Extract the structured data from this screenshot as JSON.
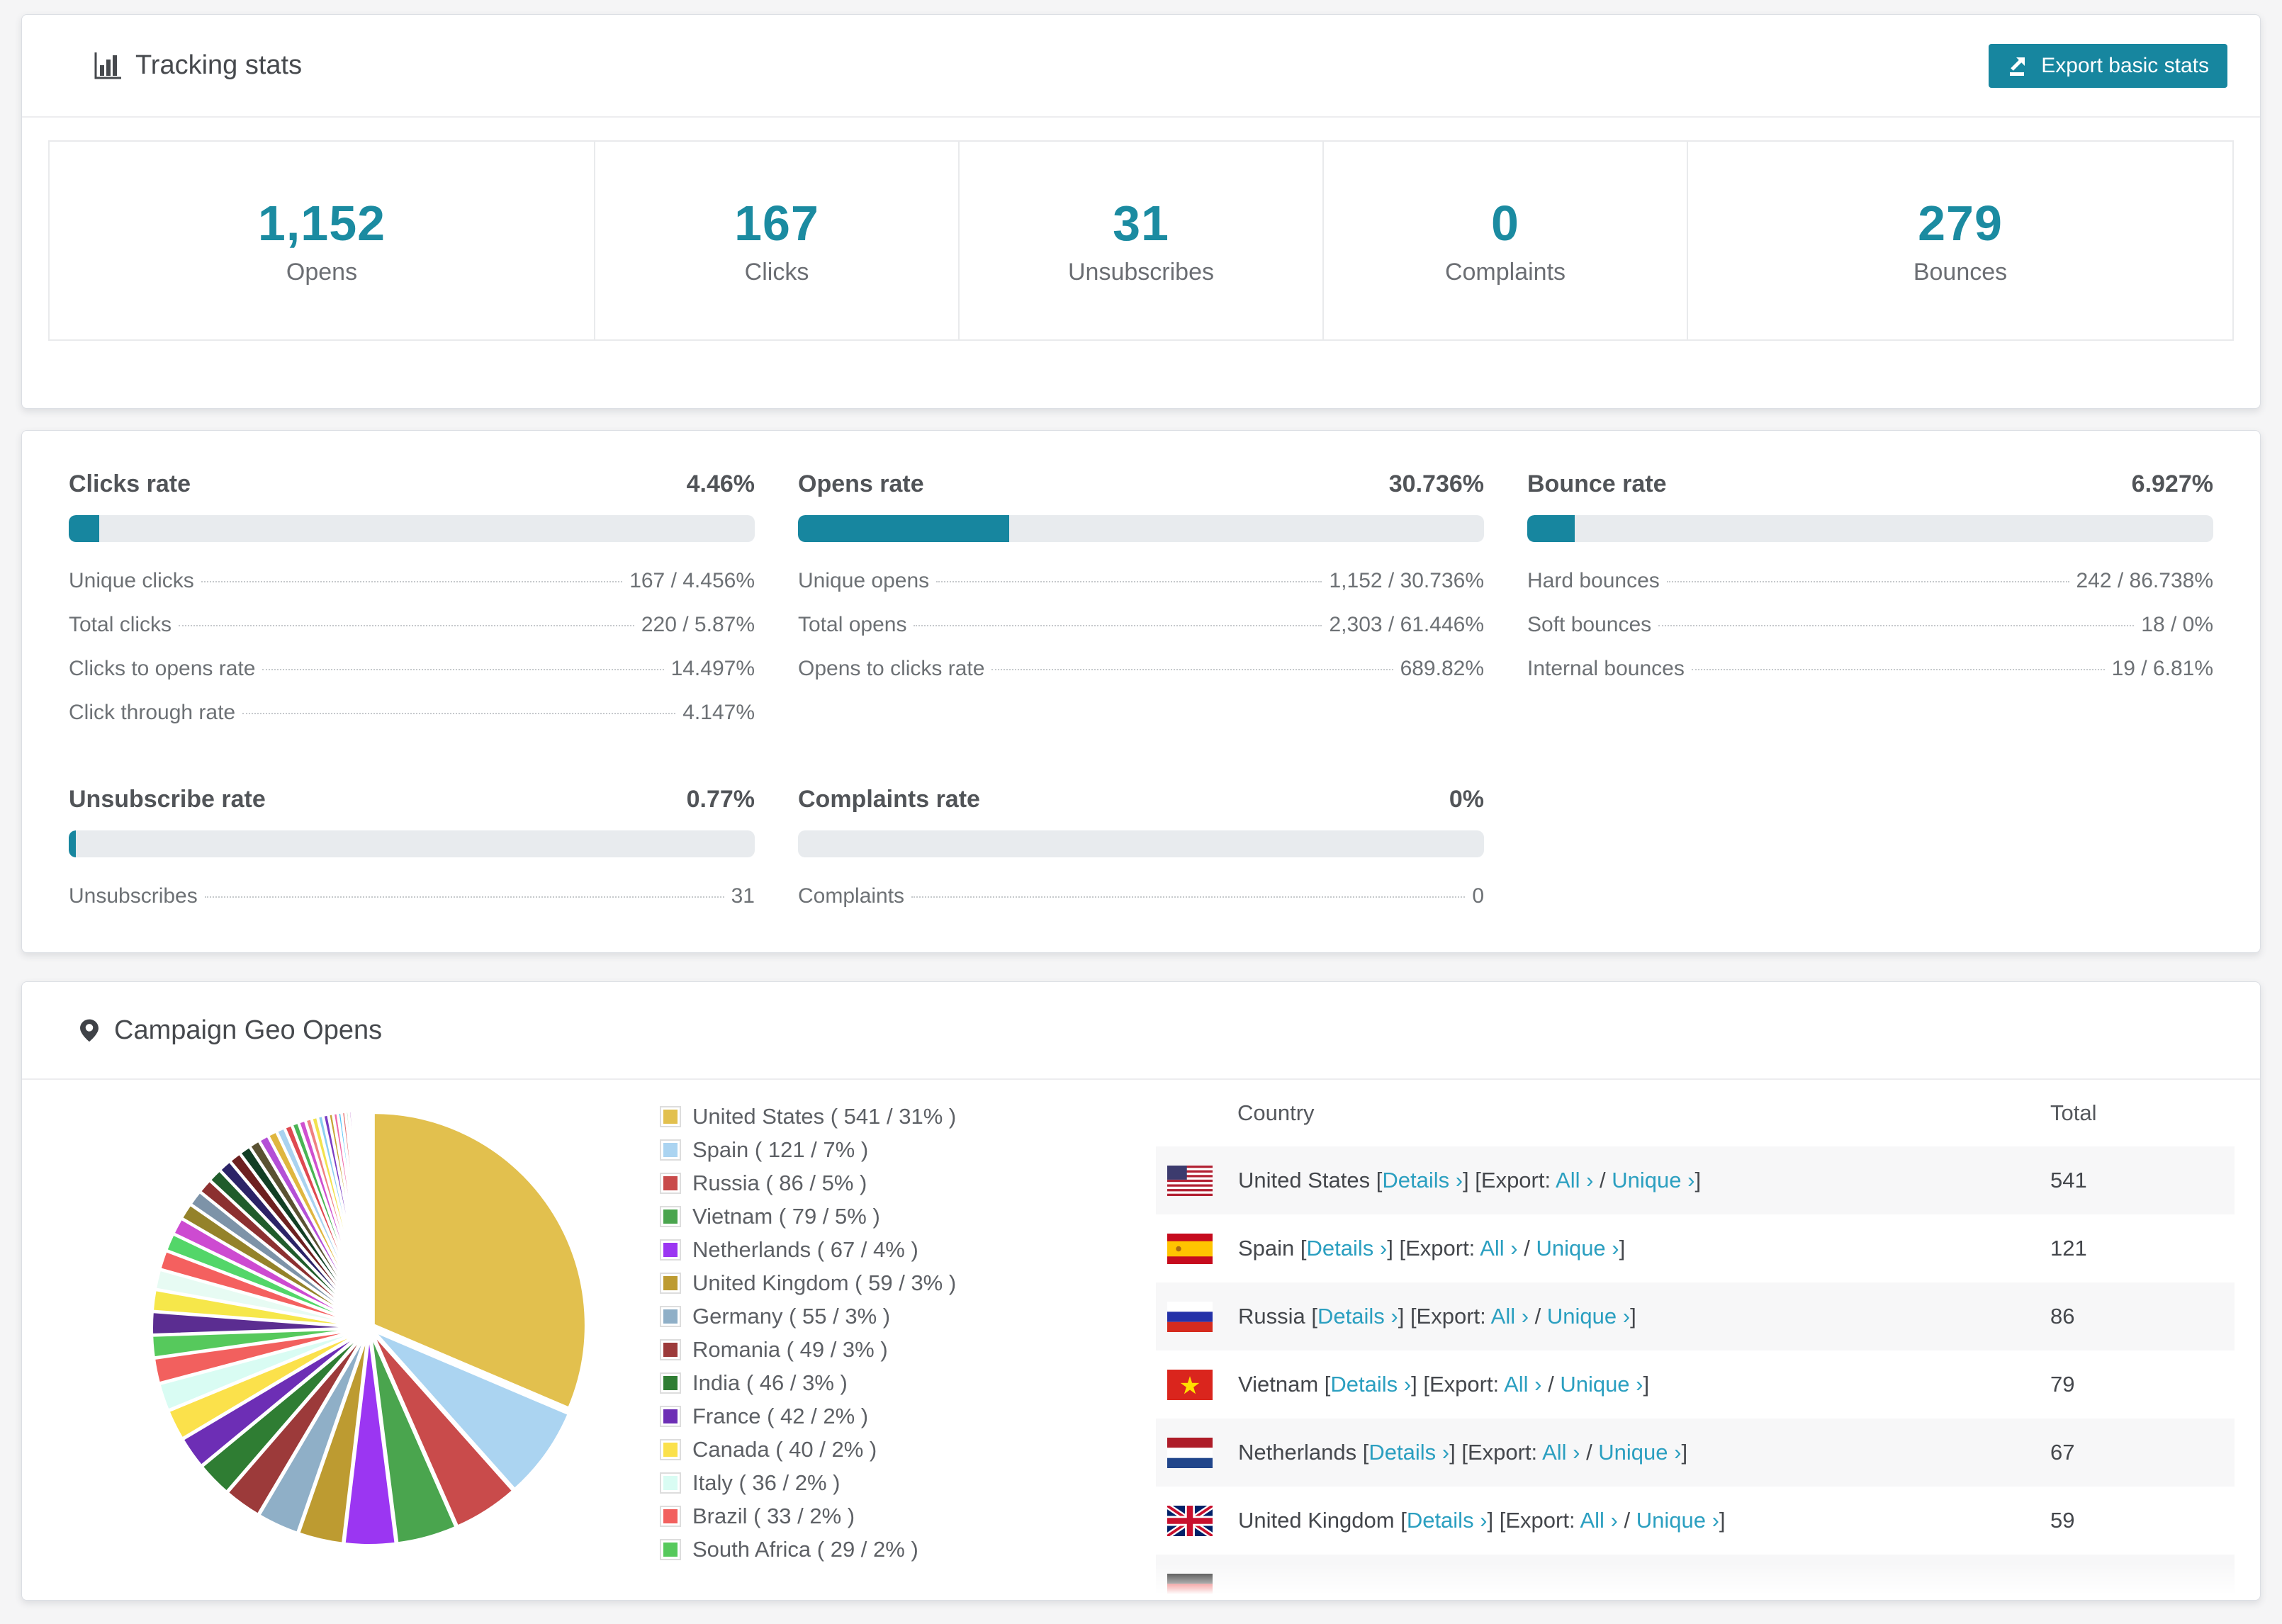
{
  "colors": {
    "accent_teal": "#17869f",
    "stat_number_teal": "#1b8ba1",
    "link_teal": "#2b9fc0",
    "track_gray": "#e8ebee"
  },
  "tracking": {
    "title": "Tracking stats",
    "export_button": "Export basic stats",
    "stats": [
      {
        "value": "1,152",
        "label": "Opens"
      },
      {
        "value": "167",
        "label": "Clicks"
      },
      {
        "value": "31",
        "label": "Unsubscribes"
      },
      {
        "value": "0",
        "label": "Complaints"
      },
      {
        "value": "279",
        "label": "Bounces"
      }
    ]
  },
  "rates": {
    "sections": [
      {
        "title": "Clicks rate",
        "value": "4.46%",
        "percent": 4.46,
        "rows": [
          {
            "label": "Unique clicks",
            "value": "167 / 4.456%"
          },
          {
            "label": "Total clicks",
            "value": "220 / 5.87%"
          },
          {
            "label": "Clicks to opens rate",
            "value": "14.497%"
          },
          {
            "label": "Click through rate",
            "value": "4.147%"
          }
        ]
      },
      {
        "title": "Opens rate",
        "value": "30.736%",
        "percent": 30.736,
        "rows": [
          {
            "label": "Unique opens",
            "value": "1,152 / 30.736%"
          },
          {
            "label": "Total opens",
            "value": "2,303 / 61.446%"
          },
          {
            "label": "Opens to clicks rate",
            "value": "689.82%"
          }
        ]
      },
      {
        "title": "Bounce rate",
        "value": "6.927%",
        "percent": 6.927,
        "rows": [
          {
            "label": "Hard bounces",
            "value": "242 / 86.738%"
          },
          {
            "label": "Soft bounces",
            "value": "18 / 0%"
          },
          {
            "label": "Internal bounces",
            "value": "19 / 6.81%"
          }
        ]
      },
      {
        "title": "Unsubscribe rate",
        "value": "0.77%",
        "percent": 0.77,
        "rows": [
          {
            "label": "Unsubscribes",
            "value": "31"
          }
        ]
      },
      {
        "title": "Complaints rate",
        "value": "0%",
        "percent": 0,
        "rows": [
          {
            "label": "Complaints",
            "value": "0"
          }
        ]
      }
    ]
  },
  "geo": {
    "title": "Campaign Geo Opens",
    "table": {
      "headers": [
        "Country",
        "Total"
      ],
      "links": {
        "details": "Details ›",
        "export_prefix": "[Export:",
        "all": "All ›",
        "unique": "Unique ›"
      },
      "rows": [
        {
          "flag": "us",
          "country": "United States",
          "total": "541",
          "links": true
        },
        {
          "flag": "es",
          "country": "Spain",
          "total": "121",
          "links": true
        },
        {
          "flag": "ru",
          "country": "Russia",
          "total": "86",
          "links": true
        },
        {
          "flag": "vn",
          "country": "Vietnam",
          "total": "79",
          "links": true
        },
        {
          "flag": "nl",
          "country": "Netherlands",
          "total": "67",
          "links": true
        },
        {
          "flag": "gb",
          "country": "United Kingdom",
          "total": "59",
          "links": true
        },
        {
          "flag": "de",
          "country": "",
          "total": "",
          "links": false
        }
      ]
    },
    "legend": [
      {
        "label": "United States ( 541 / 31% )",
        "color": "#e2c04e"
      },
      {
        "label": "Spain ( 121 / 7% )",
        "color": "#abd4f1"
      },
      {
        "label": "Russia ( 86 / 5% )",
        "color": "#c94b4b"
      },
      {
        "label": "Vietnam ( 79 / 5% )",
        "color": "#4aa54e"
      },
      {
        "label": "Netherlands ( 67 / 4% )",
        "color": "#9b36f2"
      },
      {
        "label": "United Kingdom ( 59 / 3% )",
        "color": "#bd9b31"
      },
      {
        "label": "Germany ( 55 / 3% )",
        "color": "#8fafc7"
      },
      {
        "label": "Romania ( 49 / 3% )",
        "color": "#9c3a3a"
      },
      {
        "label": "India ( 46 / 3% )",
        "color": "#2f7d33"
      },
      {
        "label": "France ( 42 / 2% )",
        "color": "#6d2eb5"
      },
      {
        "label": "Canada ( 40 / 2% )",
        "color": "#fbe14b"
      },
      {
        "label": "Italy ( 36 / 2% )",
        "color": "#d9fcf3"
      },
      {
        "label": "Brazil ( 33 / 2% )",
        "color": "#f2605e"
      },
      {
        "label": "South Africa ( 29 / 2% )",
        "color": "#56c95c"
      }
    ],
    "chart_data": {
      "type": "pie",
      "title": "Campaign Geo Opens",
      "legend_position": "right",
      "start_angle_deg": -90,
      "direction": "clockwise",
      "series": [
        {
          "name": "United States",
          "value": 541,
          "pct": 31,
          "color": "#e2c04e"
        },
        {
          "name": "Spain",
          "value": 121,
          "pct": 7,
          "color": "#abd4f1"
        },
        {
          "name": "Russia",
          "value": 86,
          "pct": 5,
          "color": "#c94b4b"
        },
        {
          "name": "Vietnam",
          "value": 79,
          "pct": 5,
          "color": "#4aa54e"
        },
        {
          "name": "Netherlands",
          "value": 67,
          "pct": 4,
          "color": "#9b36f2"
        },
        {
          "name": "United Kingdom",
          "value": 59,
          "pct": 3,
          "color": "#bd9b31"
        },
        {
          "name": "Germany",
          "value": 55,
          "pct": 3,
          "color": "#8fafc7"
        },
        {
          "name": "Romania",
          "value": 49,
          "pct": 3,
          "color": "#9c3a3a"
        },
        {
          "name": "India",
          "value": 46,
          "pct": 3,
          "color": "#2f7d33"
        },
        {
          "name": "France",
          "value": 42,
          "pct": 2,
          "color": "#6d2eb5"
        },
        {
          "name": "Canada",
          "value": 40,
          "pct": 2,
          "color": "#fbe14b"
        },
        {
          "name": "Italy",
          "value": 36,
          "pct": 2,
          "color": "#d9fcf3"
        },
        {
          "name": "Brazil",
          "value": 33,
          "pct": 2,
          "color": "#f2605e"
        },
        {
          "name": "South Africa",
          "value": 29,
          "pct": 2,
          "color": "#56c95c"
        }
      ],
      "others_unlabeled": {
        "values": [
          30,
          28,
          26,
          25,
          23,
          22,
          21,
          20,
          19,
          18,
          17,
          16,
          15,
          14,
          13,
          12,
          11,
          10,
          9,
          9,
          8,
          8,
          7,
          7,
          6,
          6,
          5,
          5,
          4,
          4,
          3,
          3,
          3,
          2,
          2,
          2,
          2,
          1,
          1,
          1,
          1,
          1
        ],
        "colors": [
          "#5b2d91",
          "#f6e74a",
          "#e7fbf3",
          "#f4605f",
          "#53d669",
          "#cd4bd1",
          "#94822a",
          "#7d93a8",
          "#8c3030",
          "#205c2b",
          "#2b2367",
          "#6d2020",
          "#123f25",
          "#5a5232",
          "#b44fd6",
          "#dfb63f",
          "#a9d2ef",
          "#df4950",
          "#49b454",
          "#cf50cf",
          "#ef8181",
          "#f2e24d",
          "#8bcfef",
          "#7a3bc3",
          "#c7a434",
          "#ef6aa9",
          "#50c2f6",
          "#e47373",
          "#82c785",
          "#b968c7",
          "#fed44f",
          "#91c9f8",
          "#ee5350",
          "#67ba6a",
          "#aa47bb",
          "#feed58",
          "#65b4f5",
          "#eb4079",
          "#27a599",
          "#d3e057",
          "#7d57c1",
          "#5d6bc0"
        ]
      }
    }
  }
}
